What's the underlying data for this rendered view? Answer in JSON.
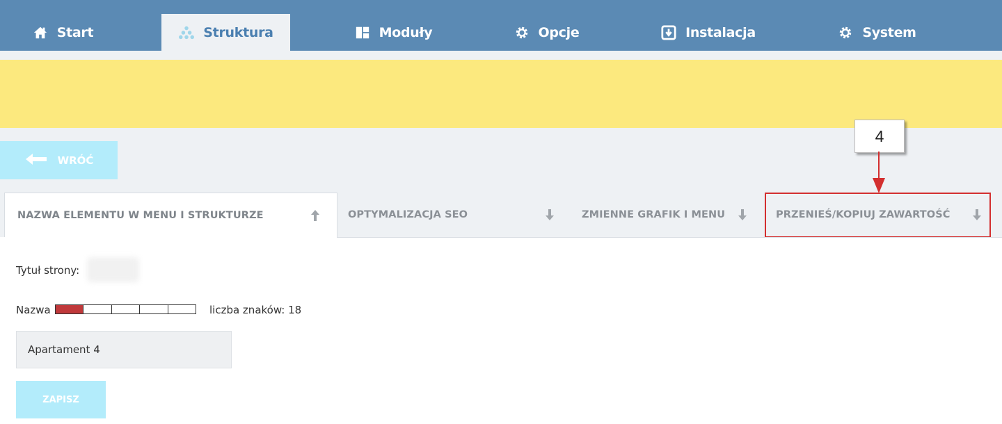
{
  "nav": {
    "items": [
      {
        "label": "Start",
        "icon": "home-icon"
      },
      {
        "label": "Struktura",
        "icon": "structure-icon",
        "active": true
      },
      {
        "label": "Moduły",
        "icon": "modules-icon"
      },
      {
        "label": "Opcje",
        "icon": "gear-icon"
      },
      {
        "label": "Instalacja",
        "icon": "install-icon"
      },
      {
        "label": "System",
        "icon": "gear-icon"
      }
    ]
  },
  "back_button": {
    "label": "WRÓĆ",
    "icon": "arrow-left-icon"
  },
  "callout": {
    "number": "4"
  },
  "tabs": [
    {
      "label": "NAZWA ELEMENTU W MENU I STRUKTURZE",
      "arrow": "up",
      "active": true
    },
    {
      "label": "OPTYMALIZACJA SEO",
      "arrow": "down"
    },
    {
      "label": "ZMIENNE GRAFIK I MENU",
      "arrow": "down"
    },
    {
      "label": "PRZENIEŚ/KOPIUJ ZAWARTOŚĆ",
      "arrow": "down",
      "highlighted": true
    }
  ],
  "form": {
    "page_title_label": "Tytuł strony:",
    "name_label": "Nazwa",
    "char_count_label": "liczba znaków: 18",
    "meter_filled_segments": 1,
    "meter_total_segments": 5,
    "name_value": "Apartament 4",
    "save_label": "ZAPISZ"
  },
  "colors": {
    "nav_bg": "#5b8ab4",
    "banner": "#fce97e",
    "button": "#b3ecfb",
    "highlight": "#d32f2f",
    "meter_fill": "#c0393b"
  }
}
